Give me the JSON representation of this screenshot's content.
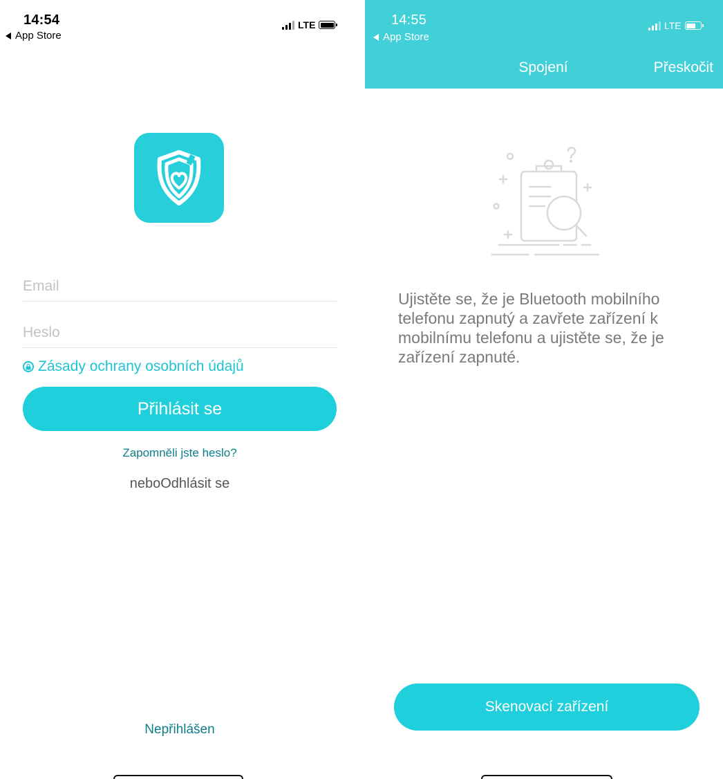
{
  "left_screen": {
    "status_bar": {
      "time": "14:54",
      "back_app": "App Store",
      "network": "LTE"
    },
    "login_form": {
      "email_placeholder": "Email",
      "password_placeholder": "Heslo",
      "privacy_link": "Zásady ochrany osobních údajů",
      "login_button": "Přihlásit se",
      "forgot_password": "Zapomněli jste heslo?",
      "or_logout": "neboOdhlásit se"
    },
    "footer": {
      "not_logged_in": "Nepřihlášen"
    }
  },
  "right_screen": {
    "status_bar": {
      "time": "14:55",
      "back_app": "App Store",
      "network": "LTE"
    },
    "header": {
      "title": "Spojení",
      "skip": "Přeskočit"
    },
    "instructions": "Ujistěte se, že je Bluetooth mobilního telefonu zapnutý a zavřete zařízení k mobilnímu telefonu a ujistěte se, že je zařízení zapnuté.",
    "scan_button": "Skenovací zařízení"
  },
  "colors": {
    "accent": "#20cfdc",
    "header": "#41cfd8",
    "link_dark": "#0e7e8a"
  },
  "icons": [
    "app-logo-shield-heart",
    "lock-icon",
    "clipboard-search-illustration",
    "signal-icon",
    "battery-icon"
  ]
}
